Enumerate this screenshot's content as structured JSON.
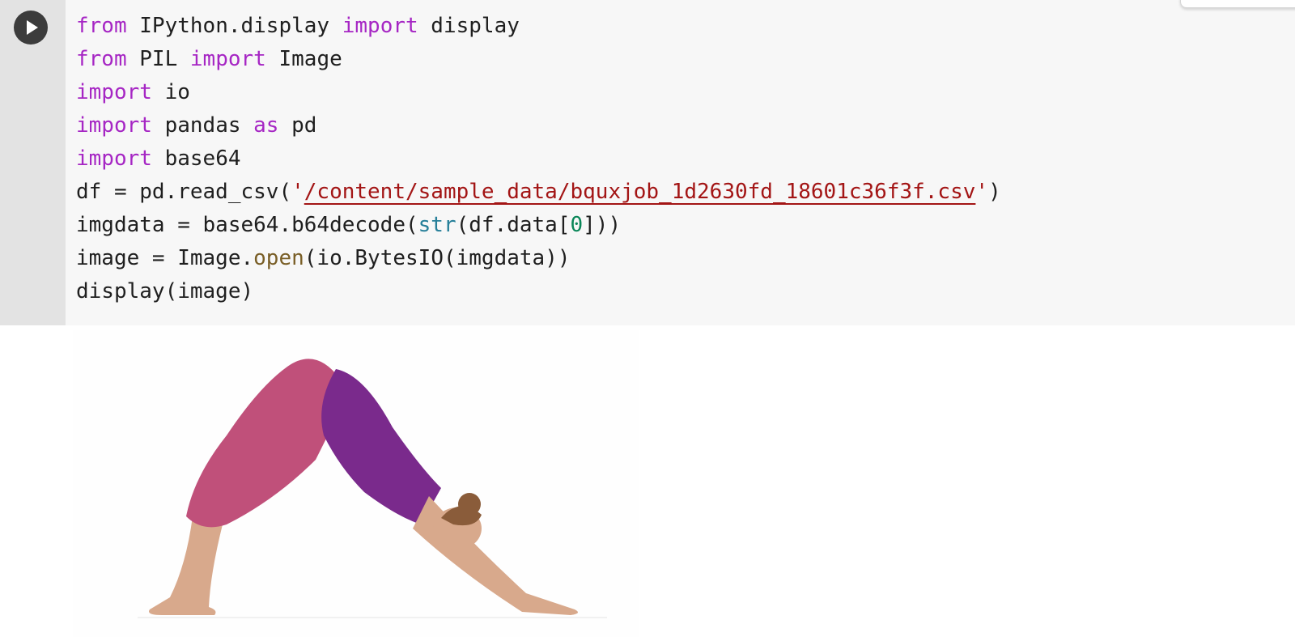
{
  "cell": {
    "run_button_label": "Run cell",
    "code_lines": [
      [
        {
          "t": "from",
          "c": "kw"
        },
        {
          "t": " IPython.display "
        },
        {
          "t": "import",
          "c": "kw"
        },
        {
          "t": " display"
        }
      ],
      [
        {
          "t": "from",
          "c": "kw"
        },
        {
          "t": " PIL "
        },
        {
          "t": "import",
          "c": "kw"
        },
        {
          "t": " Image"
        }
      ],
      [
        {
          "t": "import",
          "c": "kw"
        },
        {
          "t": " io"
        }
      ],
      [
        {
          "t": "import",
          "c": "kw"
        },
        {
          "t": " pandas "
        },
        {
          "t": "as",
          "c": "kw"
        },
        {
          "t": " pd"
        }
      ],
      [
        {
          "t": "import",
          "c": "kw"
        },
        {
          "t": " base64"
        }
      ],
      [
        {
          "t": "df = pd.read_csv("
        },
        {
          "t": "'",
          "c": "str"
        },
        {
          "t": "/content/sample_data/bquxjob_1d2630fd_18601c36f3f.csv",
          "c": "str-link"
        },
        {
          "t": "'",
          "c": "str"
        },
        {
          "t": ")"
        }
      ],
      [
        {
          "t": "imgdata = base64.b64decode("
        },
        {
          "t": "str",
          "c": "bi"
        },
        {
          "t": "(df.data["
        },
        {
          "t": "0",
          "c": "num"
        },
        {
          "t": "]))"
        }
      ],
      [
        {
          "t": "image = Image."
        },
        {
          "t": "open",
          "c": "fn"
        },
        {
          "t": "(io.BytesIO(imgdata))"
        }
      ],
      [
        {
          "t": "display(image)"
        }
      ]
    ]
  },
  "output": {
    "image_subject": "woman-in-downward-dog-yoga-pose",
    "colors": {
      "top": "#7a2a8c",
      "leggings": "#c0507a",
      "skin": "#d8a98c",
      "hair": "#8a5c3a"
    }
  }
}
